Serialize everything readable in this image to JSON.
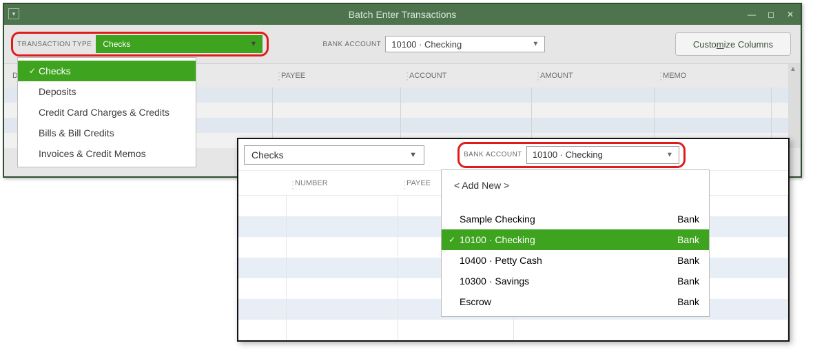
{
  "window": {
    "title": "Batch Enter Transactions"
  },
  "toolbar": {
    "transaction_type_label": "TRANSACTION TYPE",
    "transaction_type_value": "Checks",
    "transaction_type_options": {
      "checks": "Checks",
      "deposits": "Deposits",
      "cc": "Credit Card Charges & Credits",
      "bills": "Bills & Bill Credits",
      "invoices": "Invoices & Credit Memos"
    },
    "bank_account_label": "BANK ACCOUNT",
    "bank_account_value": "10100 · Checking",
    "customize_prefix": "Custo",
    "customize_ul": "m",
    "customize_suffix": "ize Columns"
  },
  "grid": {
    "columns": {
      "date": "DATE",
      "number": "NUMBER",
      "payee": "PAYEE",
      "account": "ACCOUNT",
      "amount": "AMOUNT",
      "memo": "MEMO"
    }
  },
  "inset": {
    "transaction_type_value": "Checks",
    "bank_account_label": "BANK ACCOUNT",
    "bank_account_value": "10100 · Checking",
    "add_new_label": "< Add New >",
    "accounts": {
      "a0": {
        "name": "Sample Checking",
        "type": "Bank"
      },
      "a1": {
        "name": "10100 · Checking",
        "type": "Bank"
      },
      "a2": {
        "name": "10400 · Petty Cash",
        "type": "Bank"
      },
      "a3": {
        "name": "10300 · Savings",
        "type": "Bank"
      },
      "a4": {
        "name": "Escrow",
        "type": "Bank"
      }
    },
    "columns": {
      "date": "",
      "number": "NUMBER",
      "payee": "PAYEE"
    }
  }
}
